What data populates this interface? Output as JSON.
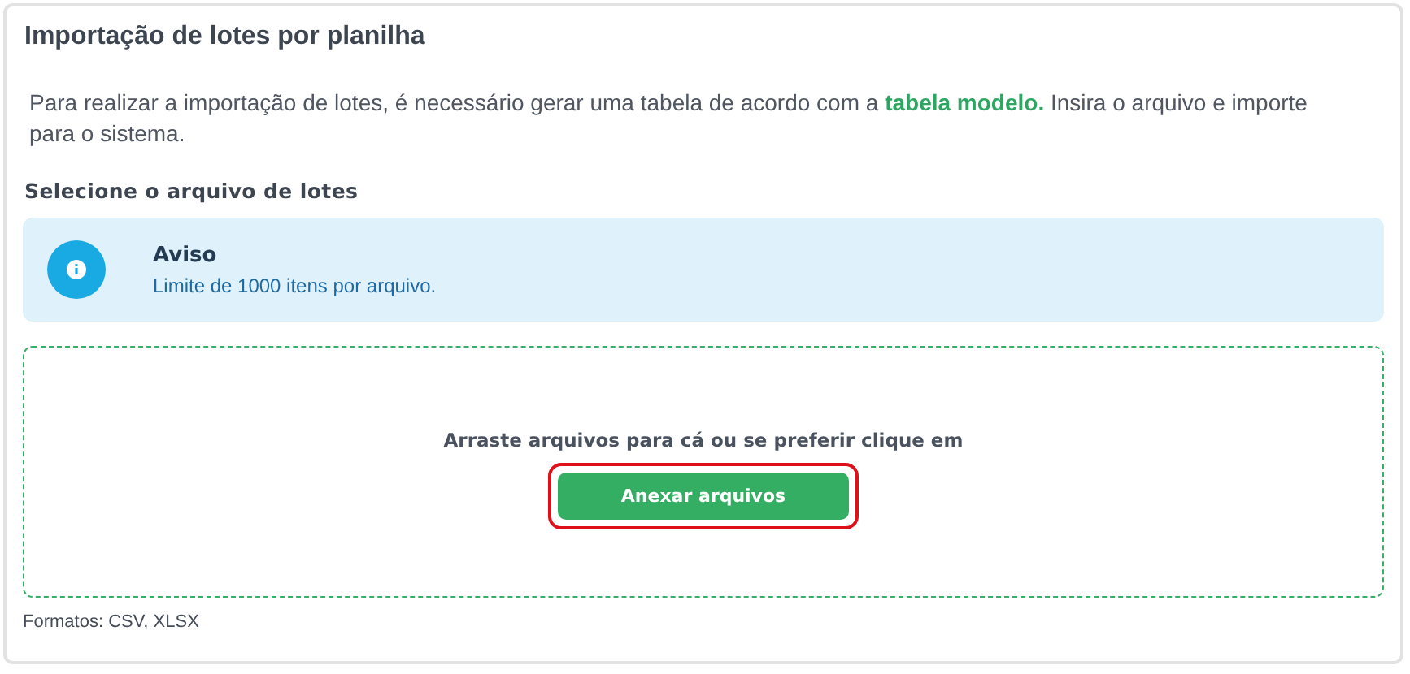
{
  "title": "Importação de lotes por planilha",
  "intro": "Para realizar a importação de lotes, é necessário gerar uma tabela de acordo com a **tabela modelo.** Insira o arquivo e importe para o sistema.",
  "section_heading": "Selecione o arquivo de lotes",
  "notice": {
    "title": "Aviso",
    "text": "Limite de 1000 itens por arquivo."
  },
  "dropzone": {
    "prompt": "Arraste arquivos para cá ou se preferir clique em",
    "button": {
      "label": "Anexar arquivos",
      "focused": true
    }
  },
  "formats": "Formatos: CSV, XLSX"
}
